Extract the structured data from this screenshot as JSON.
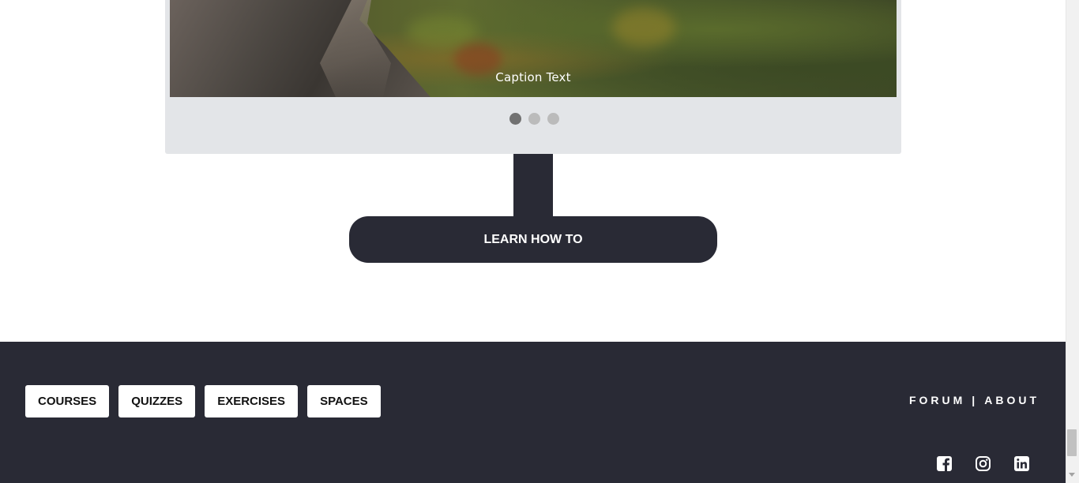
{
  "slideshow": {
    "caption": "Caption Text",
    "slides_count": 3,
    "active_slide": 1
  },
  "cta": {
    "label": "LEARN HOW TO"
  },
  "footer": {
    "nav": [
      {
        "label": "COURSES"
      },
      {
        "label": "QUIZZES"
      },
      {
        "label": "EXERCISES"
      },
      {
        "label": "SPACES"
      }
    ],
    "links": {
      "forum": "FORUM",
      "separator": "|",
      "about": "ABOUT"
    },
    "social": [
      "facebook-icon",
      "instagram-icon",
      "linkedin-icon"
    ]
  },
  "colors": {
    "dark": "#292a35",
    "panel": "#e3e5e8",
    "dot_active": "#717171",
    "dot_inactive": "#bbbbbb"
  }
}
